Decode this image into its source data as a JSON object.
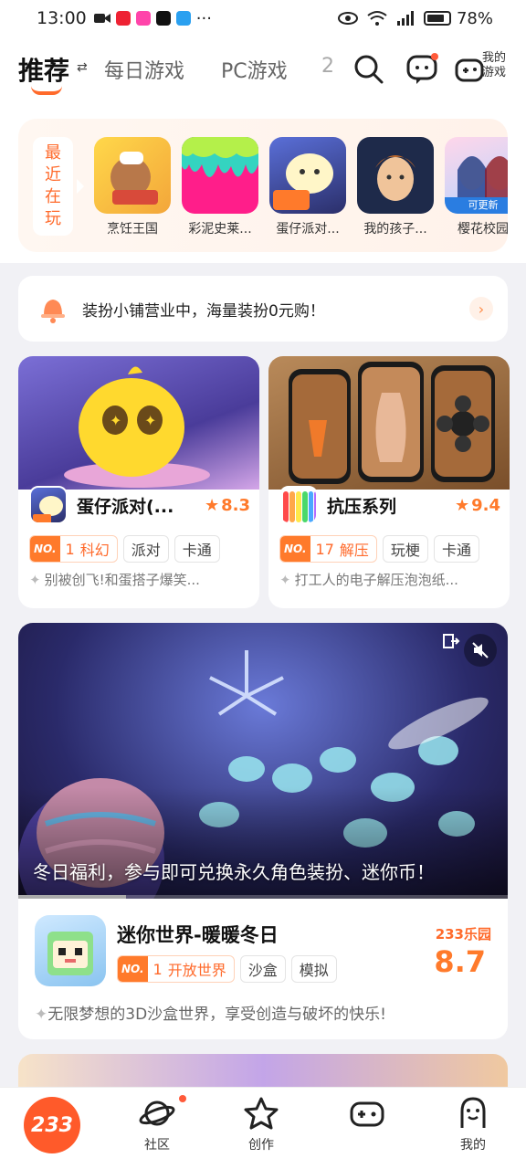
{
  "status_bar": {
    "time": "13:00",
    "battery": "78%"
  },
  "header": {
    "tabs": [
      "推荐",
      "每日游戏",
      "PC游戏",
      "2"
    ],
    "my_games_label": "我的游戏"
  },
  "recent": {
    "label": "最近在玩",
    "items": [
      {
        "name": "烹饪王国"
      },
      {
        "name": "彩泥史莱..."
      },
      {
        "name": "蛋仔派对..."
      },
      {
        "name": "我的孩子..."
      },
      {
        "name": "樱花校园",
        "badge": "可更新"
      }
    ]
  },
  "notice": {
    "text": "装扮小铺营业中，海量装扮0元购！",
    "more": "›"
  },
  "cards": [
    {
      "title": "蛋仔派对(...",
      "rating": "8.3",
      "rank_no": "NO.",
      "rank_num": "1",
      "rank_tag": "科幻",
      "tags": [
        "派对",
        "卡通"
      ],
      "desc": "别被创飞!和蛋搭子爆笑..."
    },
    {
      "title": "抗压系列",
      "rating": "9.4",
      "rank_no": "NO.",
      "rank_num": "17",
      "rank_tag": "解压",
      "tags": [
        "玩梗",
        "卡通"
      ],
      "desc": "打工人的电子解压泡泡纸..."
    }
  ],
  "featured": {
    "caption": "冬日福利，参与即可兑换永久角色装扮、迷你币！",
    "progress": 0.22,
    "title": "迷你世界-暖暖冬日",
    "rank_no": "NO.",
    "rank_num": "1",
    "rank_tag": "开放世界",
    "tags": [
      "沙盒",
      "模拟"
    ],
    "score_brand": "233乐园",
    "score": "8.7",
    "desc": "无限梦想的3D沙盒世界，享受创造与破坏的快乐!"
  },
  "bottom_nav": {
    "home": "233",
    "items": [
      "社区",
      "创作",
      "",
      "我的"
    ]
  },
  "colors": {
    "accent": "#ff6a2b",
    "home": "#ff5a2a"
  }
}
